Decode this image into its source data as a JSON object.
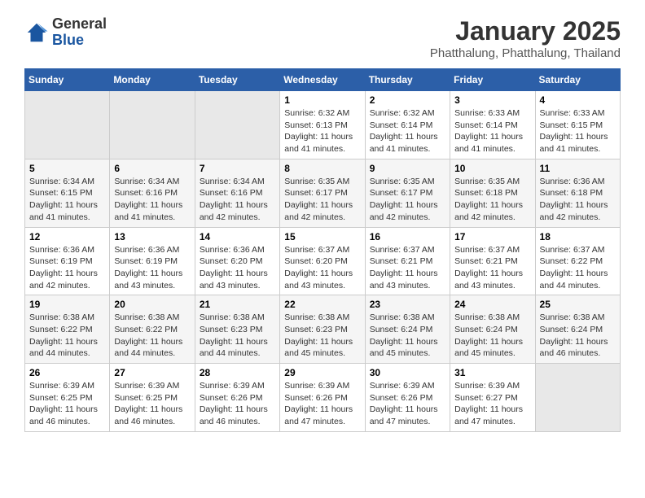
{
  "header": {
    "logo": {
      "general": "General",
      "blue": "Blue"
    },
    "title": "January 2025",
    "subtitle": "Phatthalung, Phatthalung, Thailand"
  },
  "weekdays": [
    "Sunday",
    "Monday",
    "Tuesday",
    "Wednesday",
    "Thursday",
    "Friday",
    "Saturday"
  ],
  "weeks": [
    [
      {
        "day": "",
        "info": ""
      },
      {
        "day": "",
        "info": ""
      },
      {
        "day": "",
        "info": ""
      },
      {
        "day": "1",
        "info": "Sunrise: 6:32 AM\nSunset: 6:13 PM\nDaylight: 11 hours and 41 minutes."
      },
      {
        "day": "2",
        "info": "Sunrise: 6:32 AM\nSunset: 6:14 PM\nDaylight: 11 hours and 41 minutes."
      },
      {
        "day": "3",
        "info": "Sunrise: 6:33 AM\nSunset: 6:14 PM\nDaylight: 11 hours and 41 minutes."
      },
      {
        "day": "4",
        "info": "Sunrise: 6:33 AM\nSunset: 6:15 PM\nDaylight: 11 hours and 41 minutes."
      }
    ],
    [
      {
        "day": "5",
        "info": "Sunrise: 6:34 AM\nSunset: 6:15 PM\nDaylight: 11 hours and 41 minutes."
      },
      {
        "day": "6",
        "info": "Sunrise: 6:34 AM\nSunset: 6:16 PM\nDaylight: 11 hours and 41 minutes."
      },
      {
        "day": "7",
        "info": "Sunrise: 6:34 AM\nSunset: 6:16 PM\nDaylight: 11 hours and 42 minutes."
      },
      {
        "day": "8",
        "info": "Sunrise: 6:35 AM\nSunset: 6:17 PM\nDaylight: 11 hours and 42 minutes."
      },
      {
        "day": "9",
        "info": "Sunrise: 6:35 AM\nSunset: 6:17 PM\nDaylight: 11 hours and 42 minutes."
      },
      {
        "day": "10",
        "info": "Sunrise: 6:35 AM\nSunset: 6:18 PM\nDaylight: 11 hours and 42 minutes."
      },
      {
        "day": "11",
        "info": "Sunrise: 6:36 AM\nSunset: 6:18 PM\nDaylight: 11 hours and 42 minutes."
      }
    ],
    [
      {
        "day": "12",
        "info": "Sunrise: 6:36 AM\nSunset: 6:19 PM\nDaylight: 11 hours and 42 minutes."
      },
      {
        "day": "13",
        "info": "Sunrise: 6:36 AM\nSunset: 6:19 PM\nDaylight: 11 hours and 43 minutes."
      },
      {
        "day": "14",
        "info": "Sunrise: 6:36 AM\nSunset: 6:20 PM\nDaylight: 11 hours and 43 minutes."
      },
      {
        "day": "15",
        "info": "Sunrise: 6:37 AM\nSunset: 6:20 PM\nDaylight: 11 hours and 43 minutes."
      },
      {
        "day": "16",
        "info": "Sunrise: 6:37 AM\nSunset: 6:21 PM\nDaylight: 11 hours and 43 minutes."
      },
      {
        "day": "17",
        "info": "Sunrise: 6:37 AM\nSunset: 6:21 PM\nDaylight: 11 hours and 43 minutes."
      },
      {
        "day": "18",
        "info": "Sunrise: 6:37 AM\nSunset: 6:22 PM\nDaylight: 11 hours and 44 minutes."
      }
    ],
    [
      {
        "day": "19",
        "info": "Sunrise: 6:38 AM\nSunset: 6:22 PM\nDaylight: 11 hours and 44 minutes."
      },
      {
        "day": "20",
        "info": "Sunrise: 6:38 AM\nSunset: 6:22 PM\nDaylight: 11 hours and 44 minutes."
      },
      {
        "day": "21",
        "info": "Sunrise: 6:38 AM\nSunset: 6:23 PM\nDaylight: 11 hours and 44 minutes."
      },
      {
        "day": "22",
        "info": "Sunrise: 6:38 AM\nSunset: 6:23 PM\nDaylight: 11 hours and 45 minutes."
      },
      {
        "day": "23",
        "info": "Sunrise: 6:38 AM\nSunset: 6:24 PM\nDaylight: 11 hours and 45 minutes."
      },
      {
        "day": "24",
        "info": "Sunrise: 6:38 AM\nSunset: 6:24 PM\nDaylight: 11 hours and 45 minutes."
      },
      {
        "day": "25",
        "info": "Sunrise: 6:38 AM\nSunset: 6:24 PM\nDaylight: 11 hours and 46 minutes."
      }
    ],
    [
      {
        "day": "26",
        "info": "Sunrise: 6:39 AM\nSunset: 6:25 PM\nDaylight: 11 hours and 46 minutes."
      },
      {
        "day": "27",
        "info": "Sunrise: 6:39 AM\nSunset: 6:25 PM\nDaylight: 11 hours and 46 minutes."
      },
      {
        "day": "28",
        "info": "Sunrise: 6:39 AM\nSunset: 6:26 PM\nDaylight: 11 hours and 46 minutes."
      },
      {
        "day": "29",
        "info": "Sunrise: 6:39 AM\nSunset: 6:26 PM\nDaylight: 11 hours and 47 minutes."
      },
      {
        "day": "30",
        "info": "Sunrise: 6:39 AM\nSunset: 6:26 PM\nDaylight: 11 hours and 47 minutes."
      },
      {
        "day": "31",
        "info": "Sunrise: 6:39 AM\nSunset: 6:27 PM\nDaylight: 11 hours and 47 minutes."
      },
      {
        "day": "",
        "info": ""
      }
    ]
  ]
}
